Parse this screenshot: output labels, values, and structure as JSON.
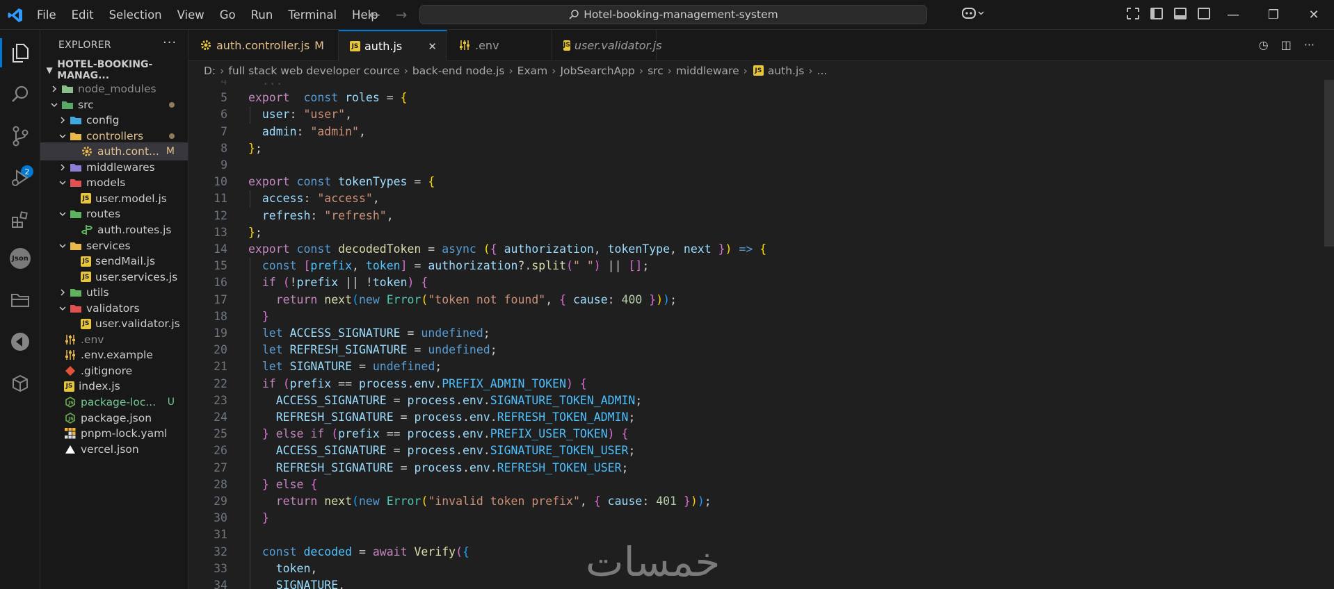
{
  "titlebar": {
    "menu": [
      "File",
      "Edit",
      "Selection",
      "View",
      "Go",
      "Run",
      "Terminal",
      "Help"
    ],
    "search_text": "Hotel-booking-management-system"
  },
  "activity": {
    "scm_badge": "2",
    "json_label": "Json"
  },
  "sidebar": {
    "title": "EXPLORER",
    "root": "HOTEL-BOOKING-MANAG...",
    "items": [
      {
        "label": "node_modules",
        "depth": 1,
        "kind": "folder",
        "open": false,
        "color": "#8bbd8b",
        "dim": true
      },
      {
        "label": "src",
        "depth": 1,
        "kind": "folder",
        "open": true,
        "color": "#59a869",
        "dot": true
      },
      {
        "label": "config",
        "depth": 2,
        "kind": "folder",
        "open": false,
        "color": "#3fa9e0"
      },
      {
        "label": "controllers",
        "depth": 2,
        "kind": "folder",
        "open": true,
        "color": "#e8b84a",
        "dot": true,
        "text_color": "#e2c08d"
      },
      {
        "label": "auth.cont...",
        "depth": 3,
        "kind": "gear",
        "color": "#e8b84a",
        "status": "M",
        "status_color": "#e2c08d",
        "text_color": "#e2c08d",
        "selected": true
      },
      {
        "label": "middlewares",
        "depth": 2,
        "kind": "folder",
        "open": false,
        "color": "#8a7fd6"
      },
      {
        "label": "models",
        "depth": 2,
        "kind": "folder",
        "open": true,
        "color": "#e05252"
      },
      {
        "label": "user.model.js",
        "depth": 3,
        "kind": "js",
        "color": "#e8c63a"
      },
      {
        "label": "routes",
        "depth": 2,
        "kind": "folder",
        "open": true,
        "color": "#5fb35f"
      },
      {
        "label": "auth.routes.js",
        "depth": 3,
        "kind": "route",
        "color": "#5fb35f"
      },
      {
        "label": "services",
        "depth": 2,
        "kind": "folder",
        "open": true,
        "color": "#e8b84a"
      },
      {
        "label": "sendMail.js",
        "depth": 3,
        "kind": "js",
        "color": "#e8c63a"
      },
      {
        "label": "user.services.js",
        "depth": 3,
        "kind": "js",
        "color": "#e8c63a"
      },
      {
        "label": "utils",
        "depth": 2,
        "kind": "folder",
        "open": false,
        "color": "#5fb35f"
      },
      {
        "label": "validators",
        "depth": 2,
        "kind": "folder",
        "open": true,
        "color": "#e05252"
      },
      {
        "label": "user.validator.js",
        "depth": 3,
        "kind": "js",
        "color": "#e8c63a"
      },
      {
        "label": ".env",
        "depth": 1,
        "kind": "env",
        "color": "#e8b84a",
        "text_color": "#8c8c8c"
      },
      {
        "label": ".env.example",
        "depth": 1,
        "kind": "env",
        "color": "#e8b84a"
      },
      {
        "label": ".gitignore",
        "depth": 1,
        "kind": "git",
        "color": "#e0533a"
      },
      {
        "label": "index.js",
        "depth": 1,
        "kind": "js",
        "color": "#e8c63a"
      },
      {
        "label": "package-loc...",
        "depth": 1,
        "kind": "node",
        "color": "#6aab54",
        "status": "U",
        "status_color": "#73c991",
        "text_color": "#73c991"
      },
      {
        "label": "package.json",
        "depth": 1,
        "kind": "node",
        "color": "#6aab54"
      },
      {
        "label": "pnpm-lock.yaml",
        "depth": 1,
        "kind": "pnpm",
        "color": "#f4b43a"
      },
      {
        "label": "vercel.json",
        "depth": 1,
        "kind": "vercel",
        "color": "#ffffff"
      }
    ]
  },
  "tabs": [
    {
      "label": "auth.controller.js",
      "status": "M",
      "icon": "gear",
      "active": false,
      "italic": false
    },
    {
      "label": "auth.js",
      "icon": "js",
      "active": true,
      "italic": false
    },
    {
      "label": ".env",
      "icon": "env",
      "active": false,
      "italic": false
    },
    {
      "label": "user.validator.js",
      "icon": "js",
      "active": false,
      "italic": true
    }
  ],
  "breadcrumb": [
    "D:",
    "full stack web developer cource",
    "back-end node.js",
    "Exam",
    "JobSearchApp",
    "src",
    "middleware",
    "auth.js",
    "..."
  ],
  "code": [
    {
      "n": "4",
      "tokens": [
        [
          "b2",
          "  ...   "
        ]
      ]
    },
    {
      "n": "5",
      "tokens": [
        [
          "kw2",
          "export"
        ],
        [
          "",
          "  "
        ],
        [
          "kw",
          "const"
        ],
        [
          "",
          ""
        ],
        [
          "v",
          " roles"
        ],
        [
          "",
          " = "
        ],
        [
          "b1",
          "{"
        ]
      ]
    },
    {
      "n": "6",
      "tokens": [
        [
          "",
          "  "
        ],
        [
          "v",
          "user"
        ],
        [
          "",
          ": "
        ],
        [
          "s",
          "\"user\""
        ],
        [
          "",
          ","
        ]
      ]
    },
    {
      "n": "7",
      "tokens": [
        [
          "",
          "  "
        ],
        [
          "v",
          "admin"
        ],
        [
          "",
          ": "
        ],
        [
          "s",
          "\"admin\""
        ],
        [
          "",
          ","
        ]
      ]
    },
    {
      "n": "8",
      "tokens": [
        [
          "b1",
          "}"
        ],
        [
          "",
          ";"
        ]
      ]
    },
    {
      "n": "9",
      "tokens": []
    },
    {
      "n": "10",
      "tokens": [
        [
          "kw2",
          "export"
        ],
        [
          "",
          " "
        ],
        [
          "kw",
          "const"
        ],
        [
          "v",
          " tokenTypes"
        ],
        [
          "",
          " = "
        ],
        [
          "b1",
          "{"
        ]
      ]
    },
    {
      "n": "11",
      "tokens": [
        [
          "",
          "  "
        ],
        [
          "v",
          "access"
        ],
        [
          "",
          ": "
        ],
        [
          "s",
          "\"access\""
        ],
        [
          "",
          ","
        ]
      ]
    },
    {
      "n": "12",
      "tokens": [
        [
          "",
          "  "
        ],
        [
          "v",
          "refresh"
        ],
        [
          "",
          ": "
        ],
        [
          "s",
          "\"refresh\""
        ],
        [
          "",
          ","
        ]
      ]
    },
    {
      "n": "13",
      "tokens": [
        [
          "b1",
          "}"
        ],
        [
          "",
          ";"
        ]
      ]
    },
    {
      "n": "14",
      "tokens": [
        [
          "kw2",
          "export"
        ],
        [
          "",
          " "
        ],
        [
          "kw",
          "const"
        ],
        [
          "",
          " "
        ],
        [
          "f",
          "decodedToken"
        ],
        [
          "",
          " = "
        ],
        [
          "kw",
          "async"
        ],
        [
          "",
          " "
        ],
        [
          "b1",
          "("
        ],
        [
          "b2",
          "{"
        ],
        [
          "",
          " "
        ],
        [
          "v",
          "authorization"
        ],
        [
          "",
          ", "
        ],
        [
          "v",
          "tokenType"
        ],
        [
          "",
          ", "
        ],
        [
          "v",
          "next"
        ],
        [
          "",
          " "
        ],
        [
          "b2",
          "}"
        ],
        [
          "b1",
          ")"
        ],
        [
          "",
          " "
        ],
        [
          "kw",
          "=>"
        ],
        [
          "",
          " "
        ],
        [
          "b1",
          "{"
        ]
      ]
    },
    {
      "n": "15",
      "tokens": [
        [
          "",
          "  "
        ],
        [
          "kw",
          "const"
        ],
        [
          "",
          " "
        ],
        [
          "b2",
          "["
        ],
        [
          "c",
          "prefix"
        ],
        [
          "",
          ", "
        ],
        [
          "c",
          "token"
        ],
        [
          "b2",
          "]"
        ],
        [
          "",
          " = "
        ],
        [
          "v",
          "authorization"
        ],
        [
          "",
          "?."
        ],
        [
          "f",
          "split"
        ],
        [
          "b2",
          "("
        ],
        [
          "s",
          "\" \""
        ],
        [
          "b2",
          ")"
        ],
        [
          "",
          " || "
        ],
        [
          "b2",
          "[]"
        ],
        [
          "",
          ";"
        ]
      ]
    },
    {
      "n": "16",
      "tokens": [
        [
          "",
          "  "
        ],
        [
          "kw2",
          "if"
        ],
        [
          "",
          " "
        ],
        [
          "b2",
          "("
        ],
        [
          "",
          "!"
        ],
        [
          "v",
          "prefix"
        ],
        [
          "",
          " || !"
        ],
        [
          "v",
          "token"
        ],
        [
          "b2",
          ")"
        ],
        [
          "",
          " "
        ],
        [
          "b2",
          "{"
        ]
      ]
    },
    {
      "n": "17",
      "tokens": [
        [
          "",
          "    "
        ],
        [
          "kw2",
          "return"
        ],
        [
          "",
          " "
        ],
        [
          "f",
          "next"
        ],
        [
          "b3",
          "("
        ],
        [
          "kw",
          "new"
        ],
        [
          "",
          " "
        ],
        [
          "t",
          "Error"
        ],
        [
          "b1",
          "("
        ],
        [
          "s",
          "\"token not found\""
        ],
        [
          "",
          ", "
        ],
        [
          "b2",
          "{"
        ],
        [
          "",
          " "
        ],
        [
          "v",
          "cause"
        ],
        [
          "",
          ": "
        ],
        [
          "n",
          "400"
        ],
        [
          "",
          " "
        ],
        [
          "b2",
          "}"
        ],
        [
          "b1",
          ")"
        ],
        [
          "b3",
          ")"
        ],
        [
          "",
          ";"
        ]
      ]
    },
    {
      "n": "18",
      "tokens": [
        [
          "",
          "  "
        ],
        [
          "b2",
          "}"
        ]
      ]
    },
    {
      "n": "19",
      "tokens": [
        [
          "",
          "  "
        ],
        [
          "kw",
          "let"
        ],
        [
          "",
          " "
        ],
        [
          "v",
          "ACCESS_SIGNATURE"
        ],
        [
          "",
          " = "
        ],
        [
          "kw",
          "undefined"
        ],
        [
          "",
          ";"
        ]
      ]
    },
    {
      "n": "20",
      "tokens": [
        [
          "",
          "  "
        ],
        [
          "kw",
          "let"
        ],
        [
          "",
          " "
        ],
        [
          "v",
          "REFRESH_SIGNATURE"
        ],
        [
          "",
          " = "
        ],
        [
          "kw",
          "undefined"
        ],
        [
          "",
          ";"
        ]
      ]
    },
    {
      "n": "21",
      "tokens": [
        [
          "",
          "  "
        ],
        [
          "kw",
          "let"
        ],
        [
          "",
          " "
        ],
        [
          "v",
          "SIGNATURE"
        ],
        [
          "",
          " = "
        ],
        [
          "kw",
          "undefined"
        ],
        [
          "",
          ";"
        ]
      ]
    },
    {
      "n": "22",
      "tokens": [
        [
          "",
          "  "
        ],
        [
          "kw2",
          "if"
        ],
        [
          "",
          " "
        ],
        [
          "b2",
          "("
        ],
        [
          "v",
          "prefix"
        ],
        [
          "",
          " == "
        ],
        [
          "v",
          "process"
        ],
        [
          "",
          "."
        ],
        [
          "v",
          "env"
        ],
        [
          "",
          "."
        ],
        [
          "c",
          "PREFIX_ADMIN_TOKEN"
        ],
        [
          "b2",
          ")"
        ],
        [
          "",
          " "
        ],
        [
          "b2",
          "{"
        ]
      ]
    },
    {
      "n": "23",
      "tokens": [
        [
          "",
          "    "
        ],
        [
          "v",
          "ACCESS_SIGNATURE"
        ],
        [
          "",
          " = "
        ],
        [
          "v",
          "process"
        ],
        [
          "",
          "."
        ],
        [
          "v",
          "env"
        ],
        [
          "",
          "."
        ],
        [
          "c",
          "SIGNATURE_TOKEN_ADMIN"
        ],
        [
          "",
          ";"
        ]
      ]
    },
    {
      "n": "24",
      "tokens": [
        [
          "",
          "    "
        ],
        [
          "v",
          "REFRESH_SIGNATURE"
        ],
        [
          "",
          " = "
        ],
        [
          "v",
          "process"
        ],
        [
          "",
          "."
        ],
        [
          "v",
          "env"
        ],
        [
          "",
          "."
        ],
        [
          "c",
          "REFRESH_TOKEN_ADMIN"
        ],
        [
          "",
          ";"
        ]
      ]
    },
    {
      "n": "25",
      "tokens": [
        [
          "",
          "  "
        ],
        [
          "b2",
          "}"
        ],
        [
          "",
          " "
        ],
        [
          "kw2",
          "else if"
        ],
        [
          "",
          " "
        ],
        [
          "b2",
          "("
        ],
        [
          "v",
          "prefix"
        ],
        [
          "",
          " == "
        ],
        [
          "v",
          "process"
        ],
        [
          "",
          "."
        ],
        [
          "v",
          "env"
        ],
        [
          "",
          "."
        ],
        [
          "c",
          "PREFIX_USER_TOKEN"
        ],
        [
          "b2",
          ")"
        ],
        [
          "",
          " "
        ],
        [
          "b2",
          "{"
        ]
      ]
    },
    {
      "n": "26",
      "tokens": [
        [
          "",
          "    "
        ],
        [
          "v",
          "ACCESS_SIGNATURE"
        ],
        [
          "",
          " = "
        ],
        [
          "v",
          "process"
        ],
        [
          "",
          "."
        ],
        [
          "v",
          "env"
        ],
        [
          "",
          "."
        ],
        [
          "c",
          "SIGNATURE_TOKEN_USER"
        ],
        [
          "",
          ";"
        ]
      ]
    },
    {
      "n": "27",
      "tokens": [
        [
          "",
          "    "
        ],
        [
          "v",
          "REFRESH_SIGNATURE"
        ],
        [
          "",
          " = "
        ],
        [
          "v",
          "process"
        ],
        [
          "",
          "."
        ],
        [
          "v",
          "env"
        ],
        [
          "",
          "."
        ],
        [
          "c",
          "REFRESH_TOKEN_USER"
        ],
        [
          "",
          ";"
        ]
      ]
    },
    {
      "n": "28",
      "tokens": [
        [
          "",
          "  "
        ],
        [
          "b2",
          "}"
        ],
        [
          "",
          " "
        ],
        [
          "kw2",
          "else"
        ],
        [
          "",
          " "
        ],
        [
          "b2",
          "{"
        ]
      ]
    },
    {
      "n": "29",
      "tokens": [
        [
          "",
          "    "
        ],
        [
          "kw2",
          "return"
        ],
        [
          "",
          " "
        ],
        [
          "f",
          "next"
        ],
        [
          "b3",
          "("
        ],
        [
          "kw",
          "new"
        ],
        [
          "",
          " "
        ],
        [
          "t",
          "Error"
        ],
        [
          "b1",
          "("
        ],
        [
          "s",
          "\"invalid token prefix\""
        ],
        [
          "",
          ", "
        ],
        [
          "b2",
          "{"
        ],
        [
          "",
          " "
        ],
        [
          "v",
          "cause"
        ],
        [
          "",
          ": "
        ],
        [
          "n",
          "401"
        ],
        [
          "",
          " "
        ],
        [
          "b2",
          "}"
        ],
        [
          "b1",
          ")"
        ],
        [
          "b3",
          ")"
        ],
        [
          "",
          ";"
        ]
      ]
    },
    {
      "n": "30",
      "tokens": [
        [
          "",
          "  "
        ],
        [
          "b2",
          "}"
        ]
      ]
    },
    {
      "n": "31",
      "tokens": []
    },
    {
      "n": "32",
      "tokens": [
        [
          "",
          "  "
        ],
        [
          "kw",
          "const"
        ],
        [
          "",
          " "
        ],
        [
          "c",
          "decoded"
        ],
        [
          "",
          " = "
        ],
        [
          "kw2",
          "await"
        ],
        [
          "",
          " "
        ],
        [
          "f",
          "Verify"
        ],
        [
          "b2",
          "("
        ],
        [
          "b3",
          "{"
        ]
      ]
    },
    {
      "n": "33",
      "tokens": [
        [
          "",
          "    "
        ],
        [
          "v",
          "token"
        ],
        [
          "",
          ","
        ]
      ]
    },
    {
      "n": "34",
      "tokens": [
        [
          "",
          "    "
        ],
        [
          "v",
          "SIGNATURE"
        ],
        [
          "",
          ","
        ]
      ]
    }
  ],
  "watermark": "خمسات"
}
